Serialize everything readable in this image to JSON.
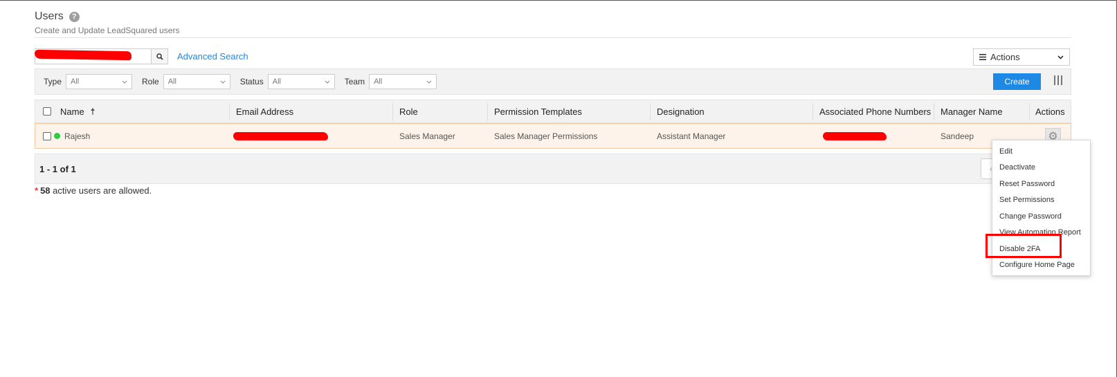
{
  "header": {
    "title": "Users",
    "subtitle": "Create and Update LeadSquared users"
  },
  "search": {
    "placeholder": "",
    "advanced_link": "Advanced Search"
  },
  "actions_dropdown": {
    "label": "Actions"
  },
  "filters": [
    {
      "label": "Type",
      "value": "All"
    },
    {
      "label": "Role",
      "value": "All"
    },
    {
      "label": "Status",
      "value": "All"
    },
    {
      "label": "Team",
      "value": "All"
    }
  ],
  "toolbar": {
    "create_label": "Create"
  },
  "table": {
    "columns": [
      "Name",
      "Email Address",
      "Role",
      "Permission Templates",
      "Designation",
      "Associated Phone Numbers",
      "Manager Name",
      "Actions"
    ],
    "rows": [
      {
        "name": "Rajesh",
        "email": "",
        "role": "Sales Manager",
        "permission_template": "Sales Manager Permissions",
        "designation": "Assistant Manager",
        "phone": "",
        "manager": "Sandeep",
        "status_color": "#2ecc40"
      }
    ]
  },
  "pagination": {
    "summary": "1 - 1 of 1"
  },
  "footnote": {
    "star": "*",
    "count": "58",
    "text": "active users are allowed."
  },
  "context_menu": {
    "items": [
      "Edit",
      "Deactivate",
      "Reset Password",
      "Set Permissions",
      "Change Password",
      "View Automation Report",
      "Disable 2FA",
      "Configure Home Page"
    ]
  },
  "colors": {
    "accent": "#1e88e5",
    "row_highlight": "#fdf3ea",
    "annotation": "#ff0000"
  }
}
